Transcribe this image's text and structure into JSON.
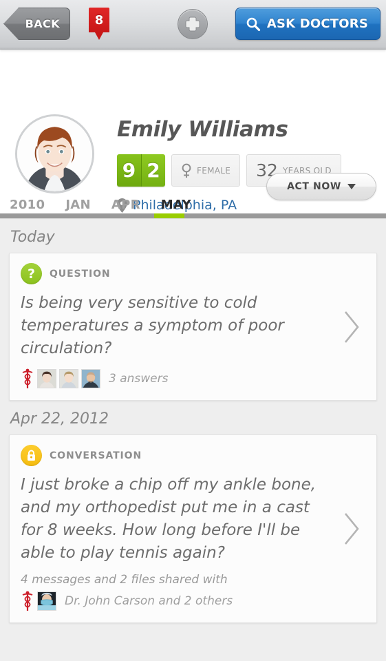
{
  "toolbar": {
    "back_label": "BACK",
    "notification_count": "8",
    "add_icon": "plus-icon",
    "search_icon": "search-icon",
    "ask_label": "ASK DOCTORS"
  },
  "profile": {
    "name": "Emily Williams",
    "avatar_icon": "user-photo",
    "score": {
      "digit1": "9",
      "digit2": "2"
    },
    "gender": {
      "icon": "female-icon",
      "label": "FEMALE"
    },
    "age": {
      "value": "32",
      "label": "YEARS OLD"
    },
    "location": {
      "icon": "map-pin-icon",
      "text": "Philadelphia, PA"
    },
    "act_now_label": "ACT NOW"
  },
  "timeline": {
    "tabs": [
      {
        "label": "2010",
        "active": false
      },
      {
        "label": "JAN",
        "active": false
      },
      {
        "label": "APR",
        "active": false
      },
      {
        "label": "MAY",
        "active": true
      }
    ],
    "marker_color": "#9acd00",
    "bar_color": "#9a9a9a"
  },
  "feed": [
    {
      "day": "Today",
      "category": "QUESTION",
      "category_icon": "question-mark-icon",
      "category_color": "#8cc21e",
      "text": "Is being very sensitive to cold temperatures a symptom of poor circulation?",
      "footer_note": "3 answers",
      "caduceus_icon": "caduceus-icon",
      "chevron_icon": "chevron-right-icon"
    },
    {
      "day": "Apr 22, 2012",
      "category": "CONVERSATION",
      "category_icon": "lock-icon",
      "category_color": "#f5bc10",
      "text": "I just broke a chip off my ankle bone, and my orthopedist put me in a cast for 8 weeks. How long before I'll be able to play tennis again?",
      "footer_line": "4 messages and 2 files shared with",
      "footer_note": "Dr. John Carson and 2 others",
      "caduceus_icon": "caduceus-icon",
      "chevron_icon": "chevron-right-icon"
    }
  ],
  "colors": {
    "accent_green": "#9acd00",
    "accent_blue": "#2f83ce",
    "accent_yellow": "#f5bc10",
    "badge_red": "#c81717",
    "link_blue": "#2e6da8"
  }
}
